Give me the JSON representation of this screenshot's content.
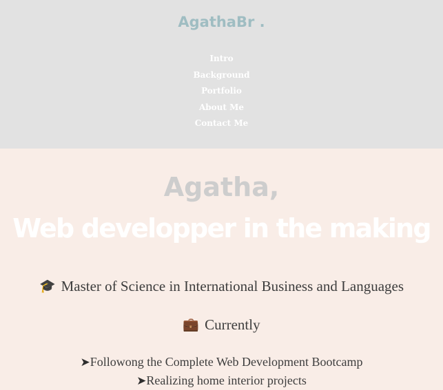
{
  "brand": {
    "name": "AgathaBr ."
  },
  "nav": {
    "items": [
      {
        "label": "Intro"
      },
      {
        "label": "Background"
      },
      {
        "label": "Portfolio"
      },
      {
        "label": "About Me"
      },
      {
        "label": "Contact Me"
      }
    ]
  },
  "hero": {
    "name": "Agatha,",
    "tagline": "Web developper in the making"
  },
  "education": {
    "icon": "graduation-cap-icon",
    "text": "Master of Science in International Business and Languages"
  },
  "current": {
    "icon": "briefcase-icon",
    "heading": "Currently",
    "bullet_icon": "arrow-right-icon",
    "items": [
      {
        "text": "Followong the Complete Web Development Bootcamp"
      },
      {
        "text": "Realizing home interior projects"
      }
    ]
  },
  "colors": {
    "nav_background": "#e2e2e2",
    "brand": "#9fbdc2",
    "hero_background": "#f9ede7",
    "hero_name": "#cdcdcd",
    "hero_tagline": "#ffffff",
    "body_text": "#3d3d3d"
  }
}
